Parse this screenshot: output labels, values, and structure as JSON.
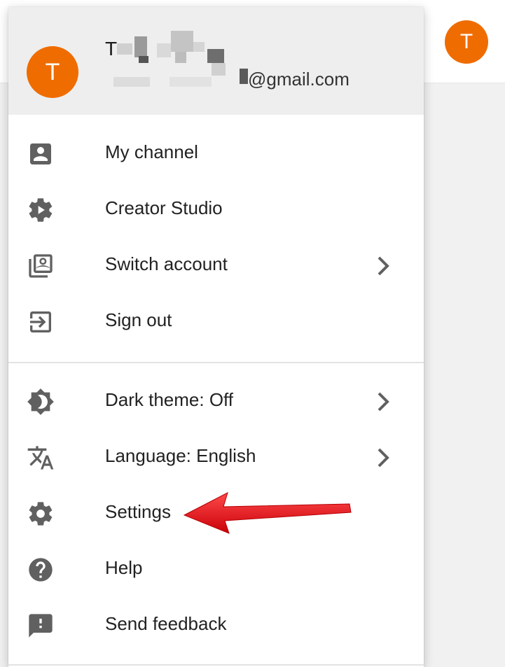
{
  "colors": {
    "avatar": "#ef6c00",
    "icon": "#606060",
    "arrow": "#e8000b"
  },
  "page": {
    "avatar_letter": "T"
  },
  "account": {
    "avatar_letter": "T",
    "name_visible": "T",
    "email_visible": "@gmail.com"
  },
  "menu": {
    "account_items": [
      {
        "label": "My channel",
        "icon": "account-box-icon"
      },
      {
        "label": "Creator Studio",
        "icon": "creator-studio-gear-icon"
      },
      {
        "label": "Switch account",
        "icon": "switch-account-icon",
        "has_submenu": true
      },
      {
        "label": "Sign out",
        "icon": "sign-out-icon"
      }
    ],
    "settings_items": [
      {
        "label": "Dark theme: Off",
        "icon": "dark-theme-icon",
        "has_submenu": true
      },
      {
        "label": "Language: English",
        "icon": "translate-icon",
        "has_submenu": true
      },
      {
        "label": "Settings",
        "icon": "settings-gear-icon"
      },
      {
        "label": "Help",
        "icon": "help-icon"
      },
      {
        "label": "Send feedback",
        "icon": "feedback-icon"
      }
    ]
  }
}
